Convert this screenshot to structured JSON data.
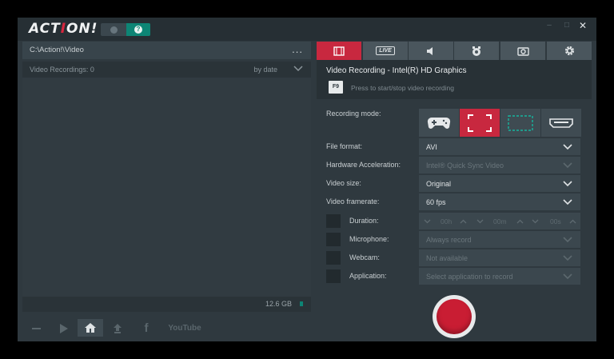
{
  "app": {
    "logo_text": "ACTION!",
    "toggle_on_glyph": "?"
  },
  "window_controls": {
    "minimize": "–",
    "maximize": "□",
    "close": "✕"
  },
  "left_panel": {
    "path": "C:\\Action!\\Video",
    "more": "...",
    "list_label": "Video Recordings: 0",
    "sort_label": "by date",
    "disk_free": "12.6 GB",
    "bottom_icons": [
      "minus-icon",
      "play-icon",
      "home-icon",
      "upload-icon",
      "facebook-icon",
      "youtube-icon"
    ],
    "youtube_label": "YouTube"
  },
  "tabs": [
    {
      "name": "video-tab-icon",
      "active": true
    },
    {
      "name": "live-tab-icon",
      "label": "LIVE"
    },
    {
      "name": "audio-tab-icon"
    },
    {
      "name": "benchmark-tab-icon"
    },
    {
      "name": "screenshot-tab-icon"
    },
    {
      "name": "settings-tab-icon"
    }
  ],
  "video": {
    "title": "Video Recording - Intel(R) HD Graphics",
    "hotkey": "F9",
    "hint": "Press to start/stop video recording",
    "recording_mode_label": "Recording mode:",
    "modes": [
      "gamepad-icon",
      "fullscreen-icon",
      "region-icon",
      "hdmi-icon"
    ],
    "file_format_label": "File format:",
    "file_format_value": "AVI",
    "hw_accel_label": "Hardware Acceleration:",
    "hw_accel_value": "Intel® Quick Sync Video",
    "video_size_label": "Video size:",
    "video_size_value": "Original",
    "framerate_label": "Video framerate:",
    "framerate_value": "60 fps",
    "duration_label": "Duration:",
    "duration_h": "00h",
    "duration_m": "00m",
    "duration_s": "00s",
    "microphone_label": "Microphone:",
    "microphone_value": "Always record",
    "webcam_label": "Webcam:",
    "webcam_value": "Not available",
    "application_label": "Application:",
    "application_value": "Select application to record"
  },
  "colors": {
    "accent": "#c8283f",
    "teal": "#0d8575",
    "panel": "#2f393f"
  }
}
